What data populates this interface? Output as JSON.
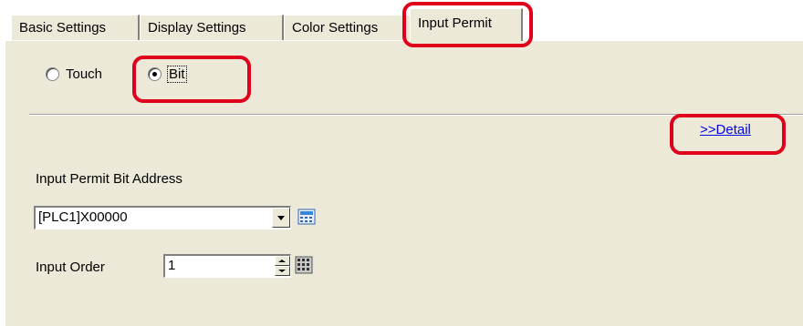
{
  "tabs": [
    {
      "label": "Basic Settings"
    },
    {
      "label": "Display Settings"
    },
    {
      "label": "Color Settings"
    },
    {
      "label": "Input Permit"
    }
  ],
  "mode": {
    "options": [
      {
        "label": "Touch",
        "checked": false
      },
      {
        "label": "Bit",
        "checked": true
      }
    ]
  },
  "detail_link": ">>Detail",
  "bit_address": {
    "label": "Input Permit Bit Address",
    "value": "[PLC1]X00000"
  },
  "input_order": {
    "label": "Input Order",
    "value": "1"
  },
  "colors": {
    "panel": "#ece9d8",
    "highlight": "#e0001b",
    "link": "#0000ee"
  }
}
